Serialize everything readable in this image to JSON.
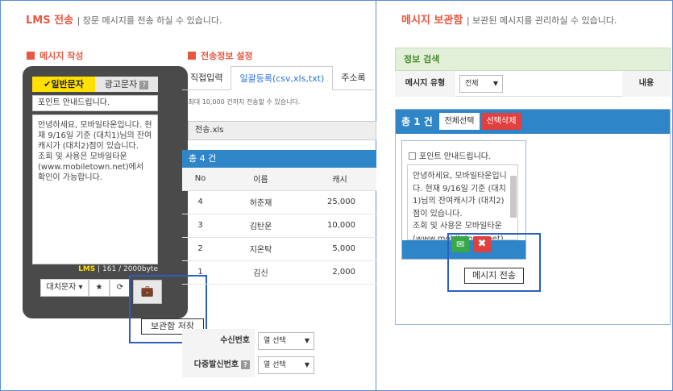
{
  "left": {
    "title": "LMS 전송",
    "subtitle": "| 장문 메시지를 전송 하실 수 있습니다.",
    "compose_section": "메시지 작성",
    "sendinfo_section": "전송정보 설정"
  },
  "phone": {
    "tab_normal": "✔일반문자",
    "tab_ad": "광고문자",
    "help_mark": "?",
    "subject": "포인트 안내드립니다.",
    "body": "안녕하세요, 모바일타운입니다. 현재 9/16일 기준 (대치1)님의 잔여캐시가 (대치2)점이 있습니다.\n조회 및 사용은 모바일타운(www.mobiletown.net)에서 확인이 가능합니다.",
    "byte_type": "LMS",
    "byte_count": "| 161 / 2000byte",
    "btn_substitute": "대치문자 ▾",
    "btn_star": "★",
    "btn_refresh": "⟳",
    "btn_save_icon": "💼"
  },
  "tooltip_save": "보관함 저장",
  "sendinfo": {
    "tabs": [
      "직접입력",
      "일괄등록(csv,xls,txt)",
      "주소록"
    ],
    "limit_note": "- 최대 10,000 건까지 전송할 수 있습니다.",
    "file_name": "전송.xls",
    "count_label": "총 4 건",
    "table_headers": [
      "No",
      "이름",
      "캐시"
    ],
    "rows": [
      {
        "no": "4",
        "name": "허준재",
        "cash": "25,000"
      },
      {
        "no": "3",
        "name": "김탄운",
        "cash": "10,000"
      },
      {
        "no": "2",
        "name": "지온탁",
        "cash": "5,000"
      },
      {
        "no": "1",
        "name": "김신",
        "cash": "2,000"
      }
    ],
    "receiver_label": "수신번호",
    "multi_label": "다중발신번호",
    "col_select": "열 선택",
    "arrow": "▼"
  },
  "right": {
    "title": "메시지 보관함",
    "subtitle": "| 보관된 메시지를 관리하실 수 있습니다.",
    "search_header": "정보 검색",
    "type_label": "메시지 유형",
    "type_value": "전체",
    "content_label": "내용",
    "total": "총 1 건",
    "select_all": "전체선택",
    "delete_selected": "선택삭제",
    "card_subject": "포인트 안내드립니다.",
    "card_body": "안녕하세요, 모바일타운입니다. 현재 9/16일 기준 (대치1)님의 잔여캐시가 (대치2)점이 있습니다.\n조회 및 사용은 모바일타운(www.mobiletown.net)",
    "send_icon": "✉",
    "delete_icon": "✖"
  },
  "tooltip_send": "메시지 전송"
}
